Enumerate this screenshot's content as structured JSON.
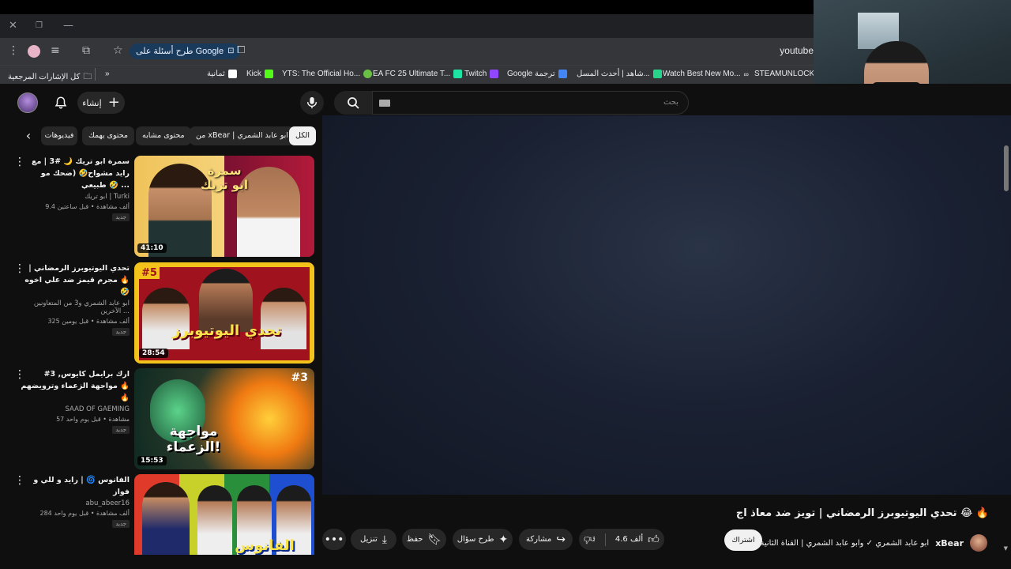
{
  "browser": {
    "omnibox_pill": "طرح أسئلة على Google",
    "url": "youtube",
    "bookmarks": [
      {
        "label": "كل الإشارات المرجعية",
        "color": "#9aa0a6"
      },
      {
        "label": "ثمانية",
        "color": "#222222"
      },
      {
        "label": "Kick",
        "color": "#53fc18"
      },
      {
        "label": "YTS: The Official Ho...",
        "color": "#6ac045"
      },
      {
        "label": "EA FC 25 Ultimate T...",
        "color": "#1ee3a2"
      },
      {
        "label": "Twitch",
        "color": "#9146ff"
      },
      {
        "label": "Google ترجمة",
        "color": "#4285f4"
      },
      {
        "label": "شاهد | أحدث المسل...",
        "color": "#27d38a"
      },
      {
        "label": "Watch Best New Mo...",
        "color": "#d0d0d0"
      },
      {
        "label": "STEAMUNLOCKED",
        "color": "#e8eaed"
      }
    ]
  },
  "header": {
    "create_label": "إنشاء",
    "search_placeholder": "بحث"
  },
  "chips": [
    {
      "label": "الكل",
      "active": true
    },
    {
      "label": "من xBear | ابو عابد الشمري",
      "active": false
    },
    {
      "label": "محتوى مشابه",
      "active": false
    },
    {
      "label": "محتوى يهمك",
      "active": false
    },
    {
      "label": "فيديوهات",
      "active": false
    }
  ],
  "related": [
    {
      "title": "سمرة ابو تريك 🌙 #3 | مع رايد مشواح🤣 (ضحك مو طبيعي 🤣 ...",
      "channel": "ابو تريك | Turki",
      "meta": "9.4 ألف مشاهدة • قبل ساعتين",
      "badge": "جديد",
      "duration": "41:10"
    },
    {
      "title": "تحدي اليوتيوبرز الرمضاني | مجرم قيمز ضد علي اخوه 🔥 🤣",
      "channel": "ابو عابد الشمري و3 من المتعاونين الآخرين ...",
      "meta": "325 ألف مشاهدة • قبل يومين",
      "badge": "جديد",
      "duration": "28:54"
    },
    {
      "title": "#3 ارك برايمل كايوس, مواجهة الزعماء وترويضهم 🔥 🔥",
      "channel": "SAAD OF GAEMING",
      "meta": "57 مشاهدة • قبل يوم واحد",
      "badge": "جديد",
      "duration": "15:53"
    },
    {
      "title": "الفانوس 🌀 | رايد و للي و فواز",
      "channel": "abu_abeer16",
      "meta": "284 ألف مشاهدة • قبل يوم واحد",
      "badge": "جديد",
      "duration": ""
    }
  ],
  "video": {
    "title": "تحدي اليوتيوبرز الرمضاني | تويز ضد معاذ اج 😂 🔥",
    "channel_name": "xBear",
    "collab_text": "| ابو عابد الشمري ✓ وابو عابد الشمري | القناة الثانية",
    "subscribe_label": "اشتراك",
    "likes": "4.6 ألف",
    "share_label": "مشاركة",
    "ask_label": "طرح سؤال",
    "save_label": "حفظ",
    "download_label": "تنزيل"
  },
  "thumb_text": {
    "t1": "سمرة ابو تريك",
    "t2_badge": "#5",
    "t2": "تحدي اليوتيوبرز",
    "t3_badge": "#3",
    "t3": "مواجهة الزعماء!",
    "t4": "الفانوس"
  }
}
